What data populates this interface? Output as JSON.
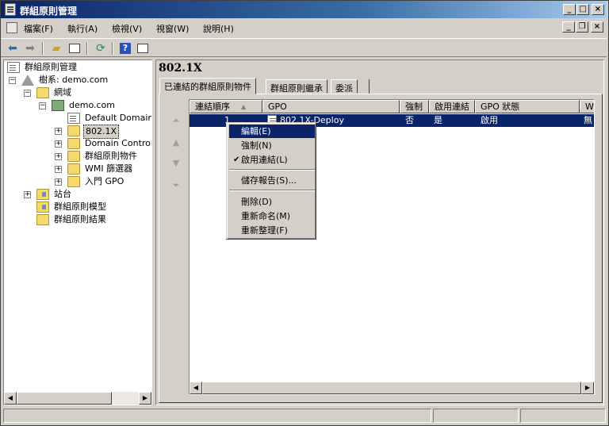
{
  "window": {
    "title": "群組原則管理"
  },
  "menubar": {
    "items": [
      {
        "label": "檔案(F)"
      },
      {
        "label": "執行(A)"
      },
      {
        "label": "檢視(V)"
      },
      {
        "label": "視窗(W)"
      },
      {
        "label": "說明(H)"
      }
    ]
  },
  "tree": {
    "root": "群組原則管理",
    "forest": "樹系: demo.com",
    "domains": "網域",
    "domain": "demo.com",
    "default_policy": "Default Domain P",
    "ou_8021x": "802.1X",
    "domain_controllers": "Domain Controlle",
    "gpo_objects": "群組原則物件",
    "wmi_filters": "WMI 篩選器",
    "starter_gpo": "入門 GPO",
    "sites": "站台",
    "modeling": "群組原則模型",
    "results": "群組原則結果"
  },
  "main": {
    "heading": "802.1X",
    "tabs": [
      {
        "label": "已連結的群組原則物件"
      },
      {
        "label": "群組原則繼承"
      },
      {
        "label": "委派"
      }
    ],
    "columns": {
      "link_order": "連結順序",
      "gpo": "GPO",
      "enforced": "強制",
      "link_enabled": "啟用連結",
      "gpo_status": "GPO 狀態",
      "wmi": "W"
    },
    "rows": [
      {
        "link_order": "1",
        "gpo": "802.1X-Deploy",
        "enforced": "否",
        "link_enabled": "是",
        "gpo_status": "啟用",
        "wmi": "無"
      }
    ]
  },
  "context_menu": {
    "items": [
      {
        "label": "編輯(E)"
      },
      {
        "label": "強制(N)"
      },
      {
        "label": "啟用連結(L)",
        "checked": true
      },
      {
        "label": "儲存報告(S)..."
      },
      {
        "label": "刪除(D)"
      },
      {
        "label": "重新命名(M)"
      },
      {
        "label": "重新整理(F)"
      }
    ]
  },
  "colors": {
    "titlebar": "#0a246a",
    "selection": "#0a246a",
    "face": "#d4d0c8"
  }
}
